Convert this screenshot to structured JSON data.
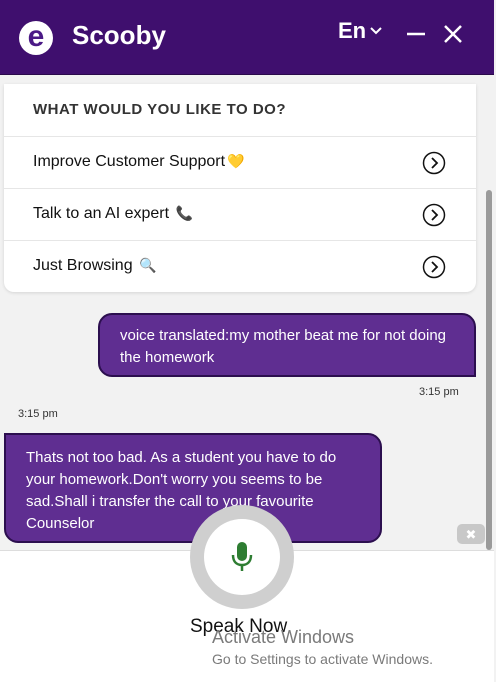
{
  "header": {
    "logo_letter": "e",
    "title": "Scooby",
    "language": "En",
    "minimize_label": "—",
    "close_label": "✕"
  },
  "menu": {
    "title": "WHAT WOULD YOU LIKE TO DO?",
    "options": [
      {
        "label": "Improve Customer Support",
        "emoji": "💛"
      },
      {
        "label": "Talk to an AI expert",
        "emoji": "📞"
      },
      {
        "label": "Just Browsing",
        "emoji": "🔍"
      }
    ]
  },
  "messages": [
    {
      "sender": "user",
      "text": "voice translated:my mother beat me for not doing the homework",
      "time": "3:15 pm"
    },
    {
      "sender": "bot",
      "text": "Thats not too bad. As a student you have to do your homework.Don't worry you seems to be sad.Shall i transfer the call to your favourite Counselor",
      "time": "3:15 pm"
    }
  ],
  "voice": {
    "label": "Speak Now",
    "mic_icon": "microphone-icon",
    "dismiss_label": "✖"
  },
  "watermark": {
    "title": "Activate Windows",
    "subtitle": "Go to Settings to activate Windows."
  },
  "colors": {
    "header_bg": "#3f0f6e",
    "bubble_bg": "#5f2e91",
    "mic_green": "#2e7d32"
  }
}
